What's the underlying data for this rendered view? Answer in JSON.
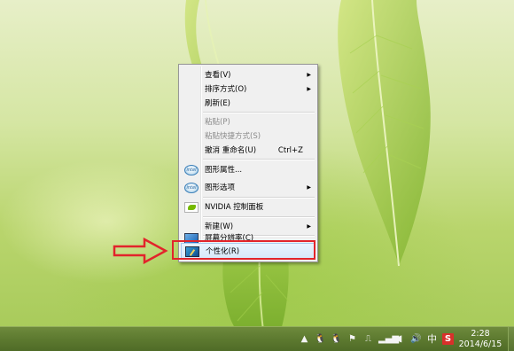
{
  "colors": {
    "highlight_box": "#e2242b",
    "menu_background": "#f0f0f0",
    "taskbar": "#5d7a30"
  },
  "context_menu": {
    "items": [
      {
        "label": "查看(V)",
        "submenu": true
      },
      {
        "label": "排序方式(O)",
        "submenu": true
      },
      {
        "label": "刷新(E)"
      },
      {
        "label": "粘贴(P)",
        "disabled": true
      },
      {
        "label": "粘贴快捷方式(S)",
        "disabled": true
      },
      {
        "label": "撤消 重命名(U)",
        "shortcut": "Ctrl+Z"
      },
      {
        "label": "图形属性...",
        "icon": "intel-graphics-icon"
      },
      {
        "label": "图形选项",
        "icon": "intel-graphics-icon",
        "submenu": true
      },
      {
        "label": "NVIDIA 控制面板",
        "icon": "nvidia-icon"
      },
      {
        "label": "新建(W)",
        "submenu": true
      },
      {
        "label": "屏幕分辨率(C)",
        "icon": "display-resolution-icon"
      },
      {
        "label": "个性化(R)",
        "icon": "personalize-icon",
        "highlighted": true
      }
    ]
  },
  "annotation": {
    "arrow": "red-outline-arrow-icon",
    "target": "个性化(R)"
  },
  "taskbar": {
    "tray_icons": [
      "chevron-up-icon",
      "qq-icon",
      "qq-icon",
      "flag-icon",
      "network-icon",
      "signal-icon",
      "volume-icon",
      "speaker-icon"
    ],
    "ime_label": "中",
    "sogou_label": "S",
    "clock_time": "2:28",
    "clock_date": "2014/6/15"
  }
}
